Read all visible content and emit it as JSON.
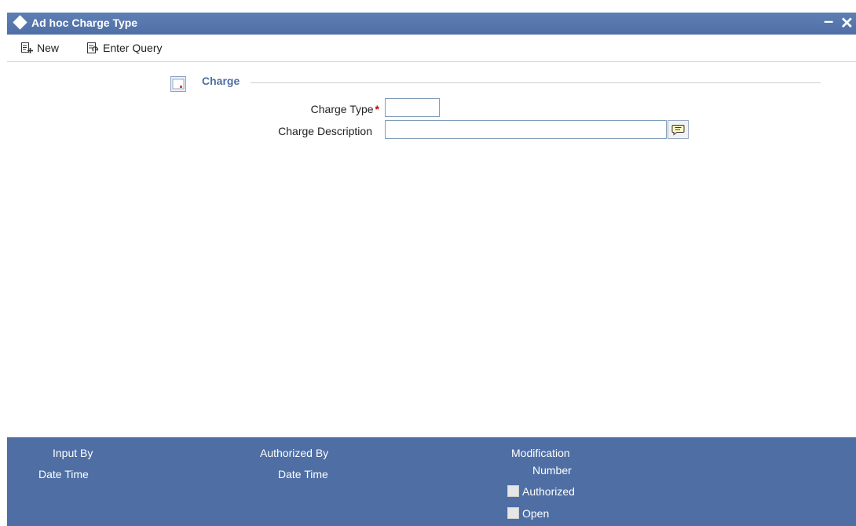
{
  "window": {
    "title": "Ad hoc Charge Type",
    "minimize_glyph": "–",
    "close_glyph": "✕"
  },
  "toolbar": {
    "new_label": "New",
    "enter_query_label": "Enter Query"
  },
  "form": {
    "section_title": "Charge",
    "charge_type": {
      "label": "Charge Type",
      "required_mark": "*",
      "value": ""
    },
    "charge_description": {
      "label": "Charge Description",
      "value": ""
    }
  },
  "footer": {
    "input_by": "Input By",
    "date_time_1": "Date Time",
    "authorized_by": "Authorized By",
    "date_time_2": "Date Time",
    "modification": "Modification",
    "number": "Number",
    "authorized": "Authorized",
    "open": "Open"
  },
  "colors": {
    "titlebar": "#5a7bb0",
    "footer": "#4e6ea4",
    "section_title": "#4e6ea4",
    "required": "#cc0000"
  },
  "icons": {
    "title": "diamond-icon",
    "new": "new-document-icon",
    "query": "enter-query-icon",
    "section": "section-collapse-icon",
    "lov": "speech-bubble-icon"
  }
}
